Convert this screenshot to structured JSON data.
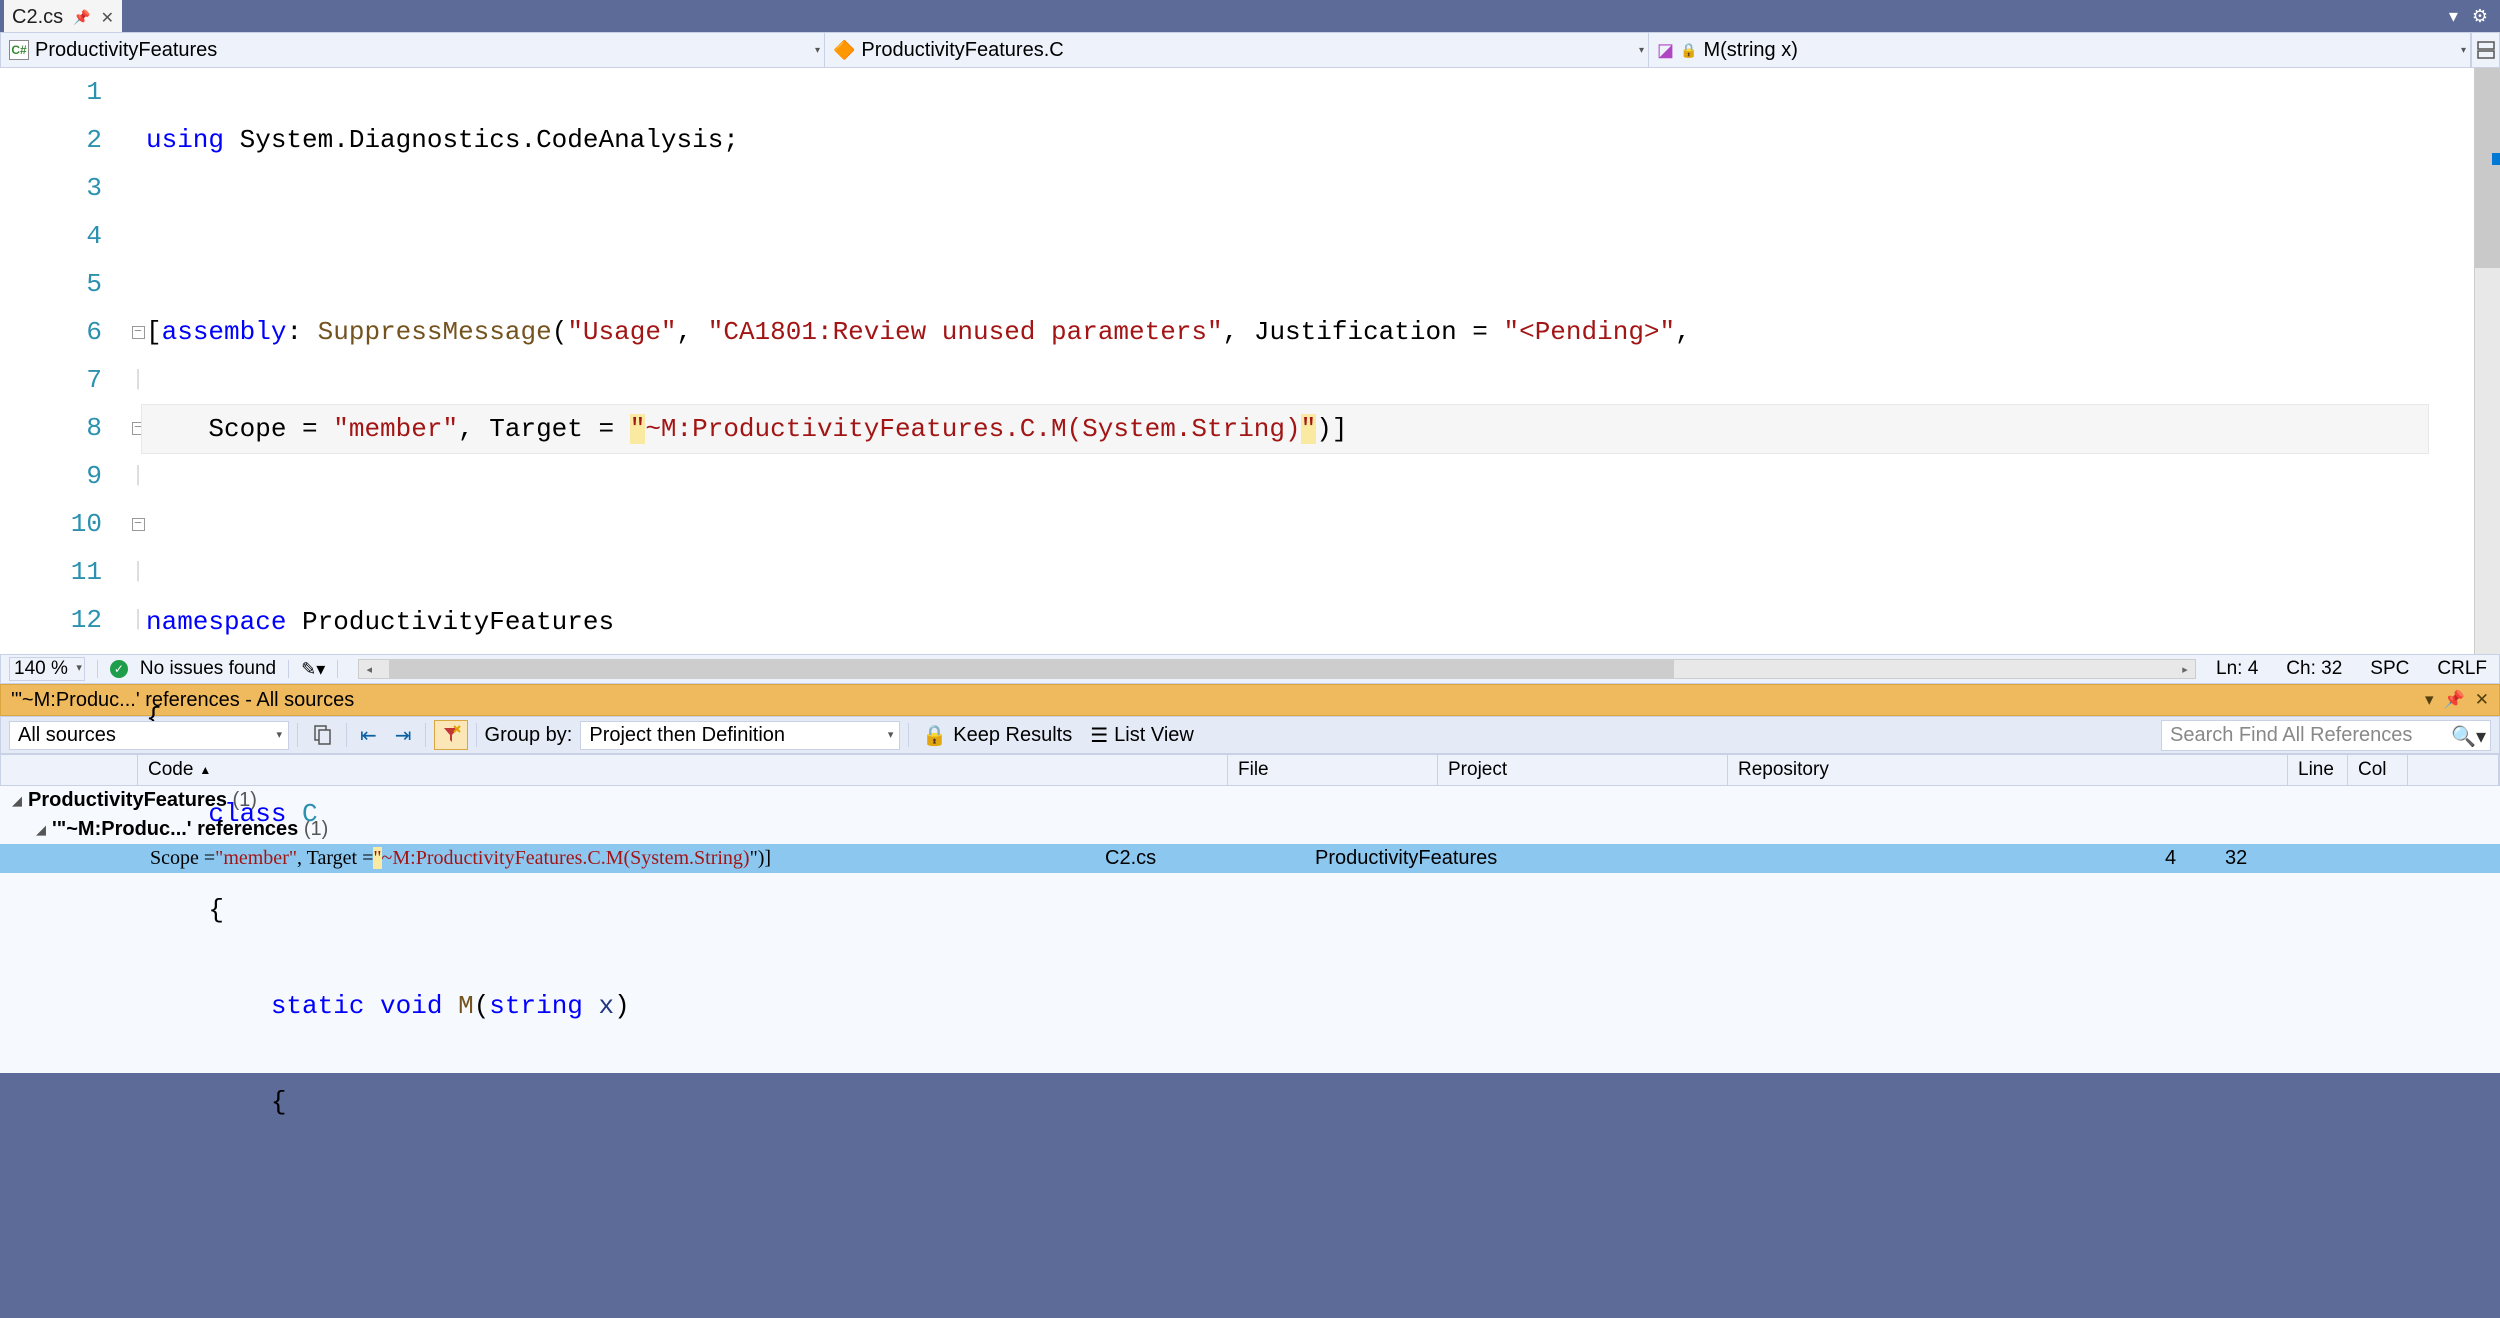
{
  "tab": {
    "filename": "C2.cs",
    "pin": "⊸",
    "close": "✕"
  },
  "titlebar": {
    "dropdown": "▾",
    "gear": "⚙"
  },
  "nav": {
    "scope": "ProductivityFeatures",
    "type": "ProductivityFeatures.C",
    "member": "M(string x)"
  },
  "code": {
    "lines": [
      "1",
      "2",
      "3",
      "4",
      "5",
      "6",
      "7",
      "8",
      "9",
      "10",
      "11",
      "12"
    ],
    "l1_using": "using",
    "l1_ns": " System.Diagnostics.CodeAnalysis;",
    "l3_open": "[",
    "l3_asm": "assembly",
    "l3_colon": ": ",
    "l3_supp": "SuppressMessage",
    "l3_p": "(",
    "l3_str1": "\"Usage\"",
    "l3_c1": ", ",
    "l3_str2": "\"CA1801:Review unused parameters\"",
    "l3_c2": ", Justification = ",
    "l3_str3": "\"<Pending>\"",
    "l3_c3": ",",
    "l4_pre": "    Scope = ",
    "l4_s1": "\"member\"",
    "l4_mid": ", Target = ",
    "l4_q1": "\"",
    "l4_bodyA": "~M:ProductivityFeatures.C.M(System.String)",
    "l4_q2": "\"",
    "l4_end": ")]",
    "l6_ns": "namespace",
    "l6_name": " ProductivityFeatures",
    "l7": "{",
    "l8_cls": "class",
    "l8_c": " C",
    "l9": "    {",
    "l10_st": "static",
    "l10_v": " void",
    "l10_m": " M",
    "l10_p": "(",
    "l10_ty": "string",
    "l10_x": " x",
    "l10_cp": ")",
    "l11": "        {"
  },
  "status": {
    "zoom": "140 %",
    "issues": "No issues found",
    "ln_label": "Ln:",
    "ln": "4",
    "ch_label": "Ch:",
    "ch": "32",
    "spc": "SPC",
    "crlf": "CRLF"
  },
  "panel": {
    "title": "'\"~M:Produc...' references - All sources",
    "toolbar": {
      "scope": "All sources",
      "groupby_label": "Group by:",
      "groupby_value": "Project then Definition",
      "keep": "Keep Results",
      "listview": "List View",
      "search_placeholder": "Search Find All References"
    },
    "columns": {
      "code": "Code",
      "file": "File",
      "project": "Project",
      "repo": "Repository",
      "line": "Line",
      "col": "Col"
    },
    "group1": "ProductivityFeatures",
    "group1_count": "(1)",
    "group2": "'\"~M:Produc...' references",
    "group2_count": "(1)",
    "result": {
      "pre": "Scope = ",
      "s1": "\"member\"",
      "mid": ", Target = ",
      "q": "\"",
      "body": "~M:ProductivityFeatures.C.M(System.String)",
      "end": "\")]",
      "file": "C2.cs",
      "project": "ProductivityFeatures",
      "line": "4",
      "col": "32"
    }
  }
}
